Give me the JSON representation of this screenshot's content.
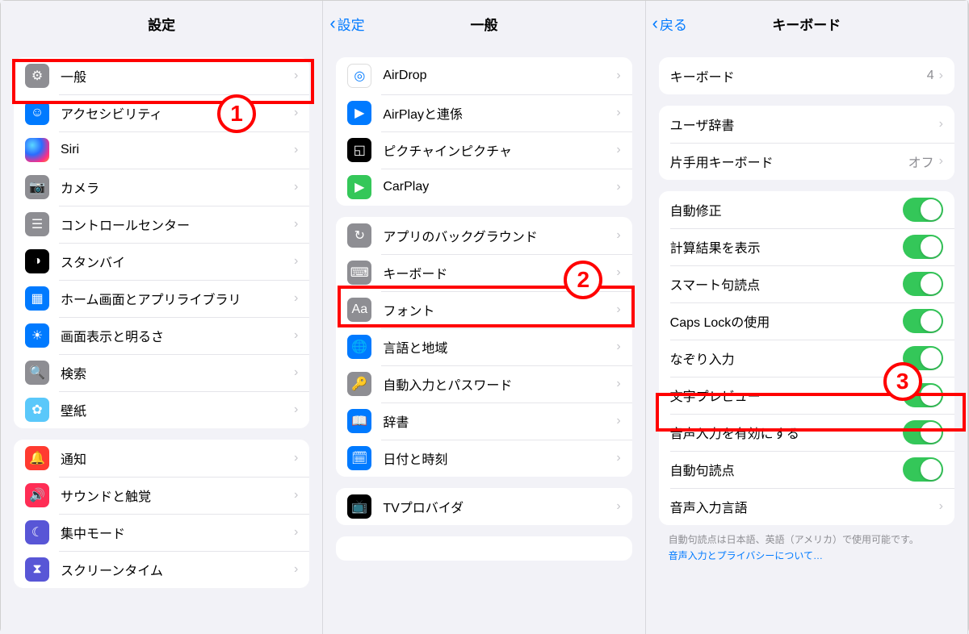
{
  "annotations": {
    "badge1": "1",
    "badge2": "2",
    "badge3": "3"
  },
  "panel1": {
    "title": "設定",
    "groupA": [
      {
        "label": "一般",
        "icon": "gear-icon",
        "bg": "bg-gray",
        "glyph": "⚙"
      },
      {
        "label": "アクセシビリティ",
        "icon": "accessibility-icon",
        "bg": "bg-blue",
        "glyph": "☺"
      },
      {
        "label": "Siri",
        "icon": "siri-icon",
        "bg": "bg-siri",
        "glyph": ""
      },
      {
        "label": "カメラ",
        "icon": "camera-icon",
        "bg": "bg-gray",
        "glyph": "📷"
      },
      {
        "label": "コントロールセンター",
        "icon": "control-center-icon",
        "bg": "bg-gray",
        "glyph": "☰"
      },
      {
        "label": "スタンバイ",
        "icon": "standby-icon",
        "bg": "bg-black",
        "glyph": "◑"
      },
      {
        "label": "ホーム画面とアプリライブラリ",
        "icon": "home-screen-icon",
        "bg": "bg-blue",
        "glyph": "▦"
      },
      {
        "label": "画面表示と明るさ",
        "icon": "brightness-icon",
        "bg": "bg-blue",
        "glyph": "☀"
      },
      {
        "label": "検索",
        "icon": "search-icon",
        "bg": "bg-gray",
        "glyph": "🔍"
      },
      {
        "label": "壁紙",
        "icon": "wallpaper-icon",
        "bg": "bg-lblue",
        "glyph": "✿"
      }
    ],
    "groupB": [
      {
        "label": "通知",
        "icon": "notifications-icon",
        "bg": "bg-red",
        "glyph": "🔔"
      },
      {
        "label": "サウンドと触覚",
        "icon": "sounds-icon",
        "bg": "bg-redv",
        "glyph": "🔊"
      },
      {
        "label": "集中モード",
        "icon": "focus-icon",
        "bg": "bg-indigo",
        "glyph": "☾"
      },
      {
        "label": "スクリーンタイム",
        "icon": "screentime-icon",
        "bg": "bg-indigo",
        "glyph": "⧗"
      }
    ]
  },
  "panel2": {
    "back": "設定",
    "title": "一般",
    "groupA": [
      {
        "label": "AirDrop",
        "icon": "airdrop-icon",
        "bg": "",
        "glyph": "◎"
      },
      {
        "label": "AirPlayと連係",
        "icon": "airplay-icon",
        "bg": "bg-blue",
        "glyph": "▶"
      },
      {
        "label": "ピクチャインピクチャ",
        "icon": "pip-icon",
        "bg": "bg-black",
        "glyph": "◱"
      },
      {
        "label": "CarPlay",
        "icon": "carplay-icon",
        "bg": "bg-green",
        "glyph": "▶"
      }
    ],
    "groupB": [
      {
        "label": "アプリのバックグラウンド",
        "icon": "background-refresh-icon",
        "bg": "bg-gray",
        "glyph": "↻"
      },
      {
        "label": "キーボード",
        "icon": "keyboard-icon",
        "bg": "bg-gray",
        "glyph": "⌨"
      },
      {
        "label": "フォント",
        "icon": "fonts-icon",
        "bg": "bg-gray",
        "glyph": "Aa"
      },
      {
        "label": "言語と地域",
        "icon": "language-icon",
        "bg": "bg-blue",
        "glyph": "🌐"
      },
      {
        "label": "自動入力とパスワード",
        "icon": "autofill-icon",
        "bg": "bg-gray",
        "glyph": "🔑"
      },
      {
        "label": "辞書",
        "icon": "dictionary-icon",
        "bg": "bg-blue",
        "glyph": "📖"
      },
      {
        "label": "日付と時刻",
        "icon": "datetime-icon",
        "bg": "bg-blue",
        "glyph": "🗓"
      }
    ],
    "groupC": [
      {
        "label": "TVプロバイダ",
        "icon": "tvprovider-icon",
        "bg": "bg-black",
        "glyph": "📺"
      }
    ]
  },
  "panel3": {
    "back": "戻る",
    "title": "キーボード",
    "groupA": [
      {
        "label": "キーボード",
        "value": "4"
      }
    ],
    "groupB": [
      {
        "label": "ユーザ辞書",
        "value": ""
      },
      {
        "label": "片手用キーボード",
        "value": "オフ"
      }
    ],
    "groupC": [
      {
        "label": "自動修正",
        "toggle": true
      },
      {
        "label": "計算結果を表示",
        "toggle": true
      },
      {
        "label": "スマート句読点",
        "toggle": true
      },
      {
        "label": "Caps Lockの使用",
        "toggle": true
      },
      {
        "label": "なぞり入力",
        "toggle": true
      },
      {
        "label": "文字プレビュー",
        "toggle": true
      },
      {
        "label": "音声入力を有効にする",
        "toggle": true
      },
      {
        "label": "自動句読点",
        "toggle": true
      },
      {
        "label": "音声入力言語",
        "chevron": true
      }
    ],
    "footer": "自動句読点は日本語、英語（アメリカ）で使用可能です。",
    "footerLink": "音声入力とプライバシーについて…"
  }
}
